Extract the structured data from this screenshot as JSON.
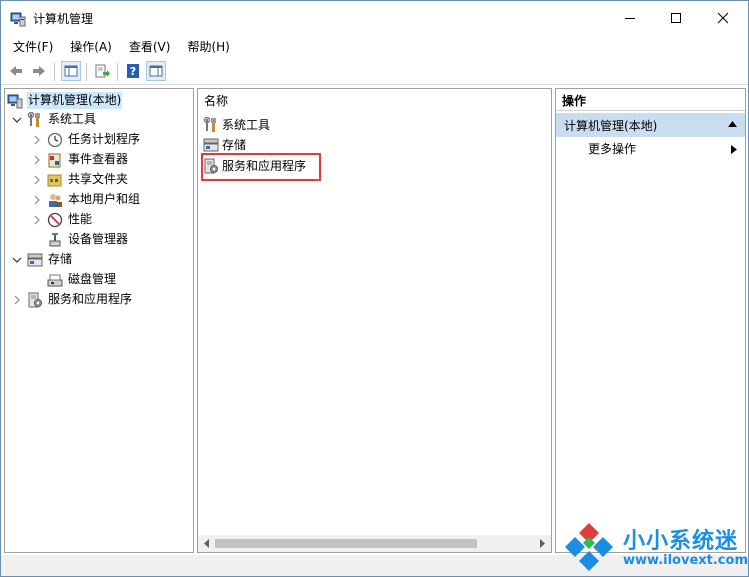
{
  "window": {
    "title": "计算机管理",
    "icon": "computer-management-icon"
  },
  "menu": {
    "items": [
      "文件(F)",
      "操作(A)",
      "查看(V)",
      "帮助(H)"
    ]
  },
  "toolbar": {
    "buttons": [
      "back-arrow-icon",
      "forward-arrow-icon",
      "show-hide-tree-icon",
      "export-list-icon",
      "help-icon",
      "show-hide-action-pane-icon"
    ]
  },
  "tree": {
    "root": "计算机管理(本地)",
    "system_tools": "系统工具",
    "task_scheduler": "任务计划程序",
    "event_viewer": "事件查看器",
    "shared_folders": "共享文件夹",
    "local_users_groups": "本地用户和组",
    "performance": "性能",
    "device_manager": "设备管理器",
    "storage": "存储",
    "disk_management": "磁盘管理",
    "services_apps": "服务和应用程序"
  },
  "list": {
    "column_name": "名称",
    "items": [
      "系统工具",
      "存储",
      "服务和应用程序"
    ]
  },
  "actions": {
    "header": "操作",
    "group": "计算机管理(本地)",
    "more": "更多操作"
  },
  "watermark": {
    "title": "小小系统迷",
    "url": "www.ilovext.com"
  },
  "colors": {
    "accent": "#1b8de3",
    "selection": "#cce8ff",
    "highlight_border": "#e03c3c",
    "actions_group_bg": "#c9ddf0"
  }
}
